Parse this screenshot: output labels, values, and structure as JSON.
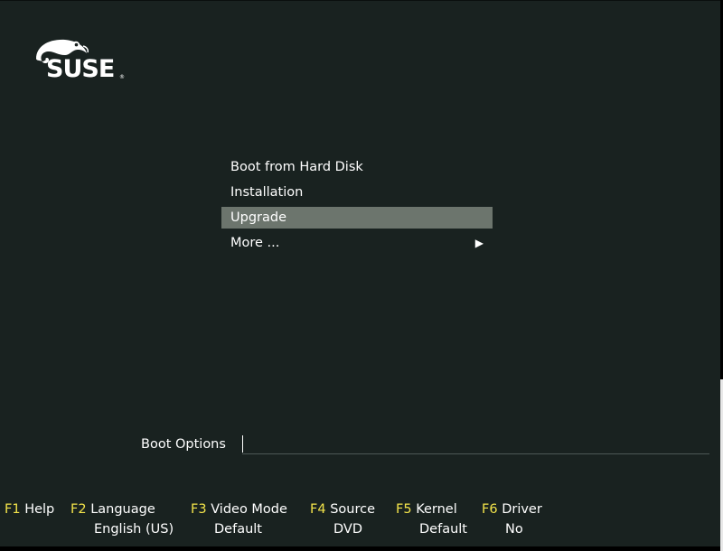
{
  "branding": {
    "logo_text": "SUSE",
    "registered_mark": "®"
  },
  "menu": {
    "items": [
      {
        "label": "Boot from Hard Disk",
        "selected": false,
        "has_submenu": false
      },
      {
        "label": "Installation",
        "selected": false,
        "has_submenu": false
      },
      {
        "label": "Upgrade",
        "selected": true,
        "has_submenu": false
      },
      {
        "label": "More ...",
        "selected": false,
        "has_submenu": true
      }
    ],
    "submenu_arrow_icon": "triangle-right-icon",
    "selection_color": "#6c756d"
  },
  "boot_options": {
    "label": "Boot Options",
    "value": ""
  },
  "function_keys": [
    {
      "key": "F1",
      "label": "Help",
      "value": ""
    },
    {
      "key": "F2",
      "label": "Language",
      "value": "English (US)"
    },
    {
      "key": "F3",
      "label": "Video Mode",
      "value": "Default"
    },
    {
      "key": "F4",
      "label": "Source",
      "value": "DVD"
    },
    {
      "key": "F5",
      "label": "Kernel",
      "value": "Default"
    },
    {
      "key": "F6",
      "label": "Driver",
      "value": "No"
    }
  ],
  "colors": {
    "background": "#192220",
    "fkey_accent": "#f2e34a",
    "text": "#ffffff"
  }
}
